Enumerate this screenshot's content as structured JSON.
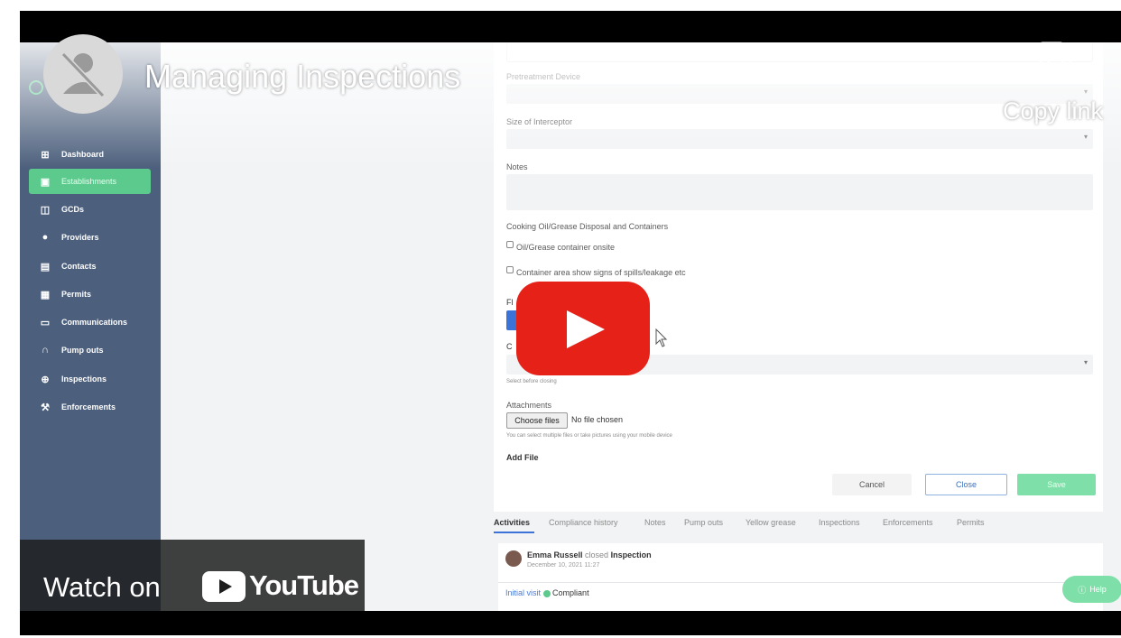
{
  "video": {
    "title": "Managing Inspections",
    "copy_link_label": "Copy link",
    "watch_on_label": "Watch on",
    "youtube_label": "YouTube"
  },
  "sidebar": {
    "items": [
      {
        "label": "Dashboard",
        "icon": "dashboard-icon"
      },
      {
        "label": "Establishments",
        "icon": "building-icon",
        "active": true
      },
      {
        "label": "GCDs",
        "icon": "gcd-icon"
      },
      {
        "label": "Providers",
        "icon": "truck-icon"
      },
      {
        "label": "Contacts",
        "icon": "contact-card-icon"
      },
      {
        "label": "Permits",
        "icon": "permit-icon"
      },
      {
        "label": "Communications",
        "icon": "chat-icon"
      },
      {
        "label": "Pump outs",
        "icon": "pump-icon"
      },
      {
        "label": "Inspections",
        "icon": "magnifier-icon"
      },
      {
        "label": "Enforcements",
        "icon": "gavel-icon"
      }
    ]
  },
  "form": {
    "pretreatment_label": "Pretreatment Device",
    "size_label": "Size of Interceptor",
    "notes_label": "Notes",
    "cooking_label": "Cooking Oil/Grease Disposal and Containers",
    "check_1": "Oil/Grease container onsite",
    "check_2": "Container area show signs of spills/leakage etc",
    "select_hint": "Select before closing",
    "attachments_label": "Attachments",
    "choose_files": "Choose files",
    "no_file": "No file chosen",
    "attach_hint": "You can select multiple files or take pictures using your mobile device",
    "add_file": "Add File",
    "cancel": "Cancel",
    "close": "Close",
    "save": "Save"
  },
  "tabs": [
    "Activities",
    "Compliance history",
    "Notes",
    "Pump outs",
    "Yellow grease",
    "Inspections",
    "Enforcements",
    "Permits"
  ],
  "activity": {
    "user": "Emma Russell",
    "action": "closed",
    "object": "Inspection",
    "date": "December 10, 2021 11:27",
    "visit_type": "Initial visit",
    "status": "Compliant"
  },
  "help_label": "Help",
  "colors": {
    "sidebar": "#4c5f7c",
    "active_item": "#5cc98d",
    "play_button": "#e62117",
    "save_button": "#7ee0a8",
    "link": "#4a7bd8"
  }
}
